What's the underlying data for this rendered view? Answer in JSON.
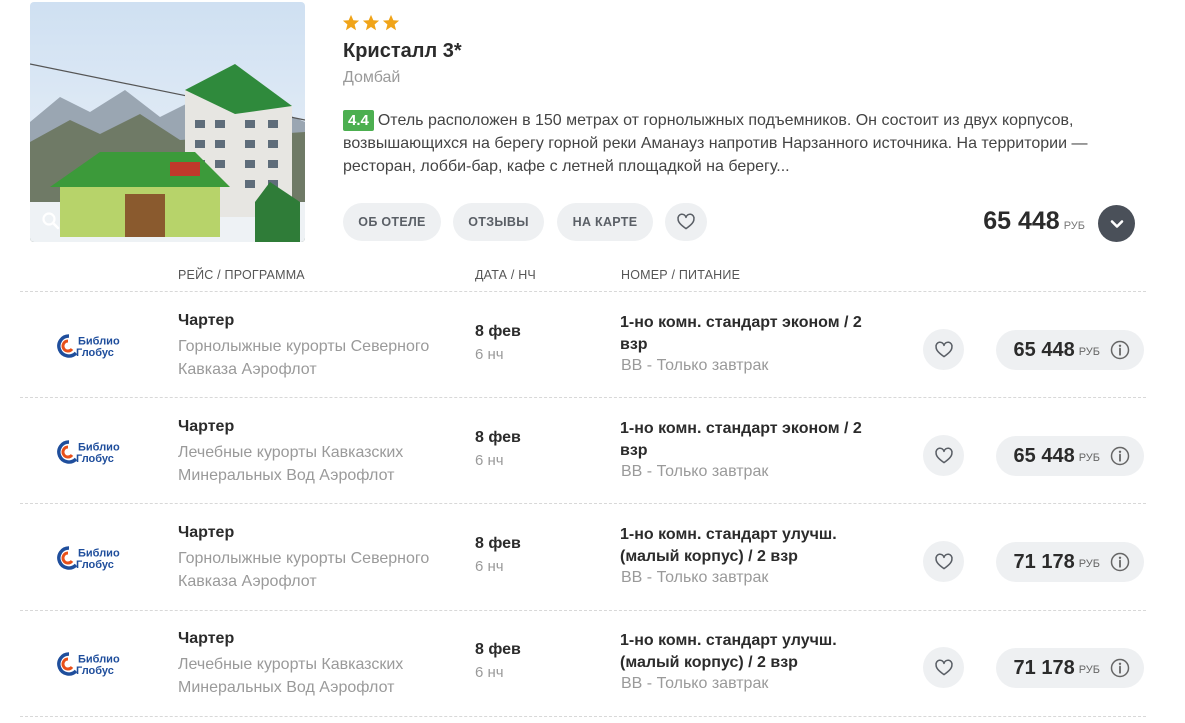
{
  "hotel": {
    "stars": 3,
    "star_color": "#f0a419",
    "name": "Кристалл 3*",
    "location": "Домбай",
    "rating": "4.4",
    "rating_color": "#4caf50",
    "description": "Отель расположен в 150 метрах от горнолыжных подъемников. Он состоит из двух корпусов, возвышающихся на берегу горной реки Аманауз напротив Нарзанного источника. На территории — ресторан, лобби-бар, кафе с летней площадкой на берегу...",
    "buttons": {
      "about": "ОБ ОТЕЛЕ",
      "reviews": "ОТЗЫВЫ",
      "map": "НА КАРТЕ"
    },
    "price": "65 448",
    "currency": "РУБ",
    "icons": {
      "zoom": "magnifier-icon",
      "favorite": "heart-icon",
      "expand": "chevron-down-icon"
    }
  },
  "columns": {
    "route": "РЕЙС / ПРОГРАММА",
    "date": "ДАТА / НЧ",
    "room": "НОМЕР / ПИТАНИЕ"
  },
  "operator_logo": {
    "line1": "Библио",
    "line2": "Глобус",
    "color": "#1f4e9c",
    "accent": "#e8501a"
  },
  "offers": [
    {
      "flight": "Чартер",
      "program": "Горнолыжные курорты Северного Кавказа Аэрофлот",
      "date": "8 фев",
      "nights": "6 нч",
      "room": "1-но комн. стандарт эконом  / 2 взр",
      "meal": "BB - Только завтрак",
      "price": "65 448",
      "currency": "РУБ"
    },
    {
      "flight": "Чартер",
      "program": "Лечебные курорты Кавказских Минеральных Вод Аэрофлот",
      "date": "8 фев",
      "nights": "6 нч",
      "room": "1-но комн. стандарт эконом  / 2 взр",
      "meal": "BB - Только завтрак",
      "price": "65 448",
      "currency": "РУБ"
    },
    {
      "flight": "Чартер",
      "program": "Горнолыжные курорты Северного Кавказа Аэрофлот",
      "date": "8 фев",
      "nights": "6 нч",
      "room": "1-но комн. стандарт улучш. (малый корпус) / 2 взр",
      "meal": "BB - Только завтрак",
      "price": "71 178",
      "currency": "РУБ"
    },
    {
      "flight": "Чартер",
      "program": "Лечебные курорты Кавказских Минеральных Вод Аэрофлот",
      "date": "8 фев",
      "nights": "6 нч",
      "room": "1-но комн. стандарт улучш. (малый корпус) / 2 взр",
      "meal": "BB - Только завтрак",
      "price": "71 178",
      "currency": "РУБ"
    }
  ]
}
